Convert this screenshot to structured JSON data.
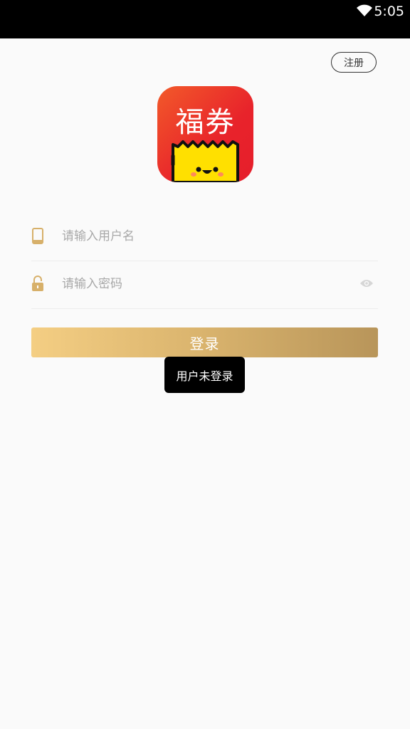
{
  "status_bar": {
    "time": "5:05",
    "wifi_icon": "wifi-icon"
  },
  "header": {
    "register_label": "注册"
  },
  "logo": {
    "text": "福券",
    "icon": "app-logo-icon",
    "colors": {
      "red": "#e8232b",
      "yellow": "#ffe000"
    }
  },
  "form": {
    "username": {
      "placeholder": "请输入用户名",
      "value": "",
      "icon": "phone-icon"
    },
    "password": {
      "placeholder": "请输入密码",
      "value": "",
      "icon": "lock-icon",
      "toggle_icon": "eye-icon"
    },
    "login_label": "登录"
  },
  "toast": {
    "message": "用户未登录"
  },
  "colors": {
    "accent_gold": "#d9b36d",
    "background": "#fafafa"
  }
}
